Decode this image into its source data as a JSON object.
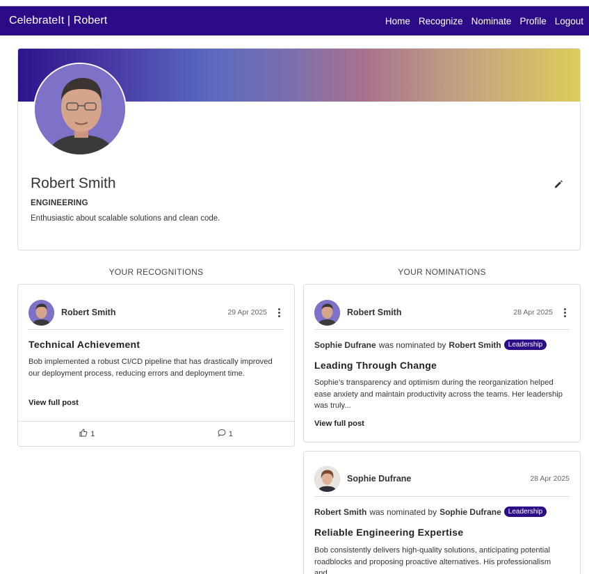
{
  "nav": {
    "brand": "CelebrateIt | Robert",
    "links": [
      "Home",
      "Recognize",
      "Nominate",
      "Profile",
      "Logout"
    ]
  },
  "profile": {
    "name": "Robert Smith",
    "department": "ENGINEERING",
    "bio": "Enthusiastic about scalable solutions and clean code."
  },
  "columns": {
    "recognitions_title": "YOUR RECOGNITIONS",
    "nominations_title": "YOUR NOMINATIONS"
  },
  "recognitions": [
    {
      "author": "Robert Smith",
      "date": "29 Apr 2025",
      "title": "Technical Achievement",
      "body": "Bob implemented a robust CI/CD pipeline that has drastically improved our deployment process, reducing errors and deployment time.",
      "view_label": "View full post",
      "likes": "1",
      "comments": "1"
    }
  ],
  "nominations": [
    {
      "author": "Robert Smith",
      "date": "28 Apr 2025",
      "nominee": "Sophie Dufrane",
      "connector": "was nominated by",
      "nominator": "Robert Smith",
      "badge": "Leadership",
      "title": "Leading Through Change",
      "body": "Sophie’s transparency and optimism during the reorganization helped ease anxiety and maintain productivity across the teams. Her leadership was truly...",
      "view_label": "View full post"
    },
    {
      "author": "Sophie Dufrane",
      "date": "28 Apr 2025",
      "nominee": "Robert Smith",
      "connector": "was nominated by",
      "nominator": "Sophie Dufrane",
      "badge": "Leadership",
      "title": "Reliable Engineering Expertise",
      "body": "Bob consistently delivers high-quality solutions, anticipating potential roadblocks and proposing proactive alternatives. His professionalism and..."
    }
  ],
  "icons": {
    "edit": "pencil-icon",
    "menu": "kebab-menu-icon",
    "like": "thumbs-up-icon",
    "comment": "comment-icon"
  },
  "colors": {
    "brand": "#2c0c86",
    "badge": "#2c0c86"
  }
}
